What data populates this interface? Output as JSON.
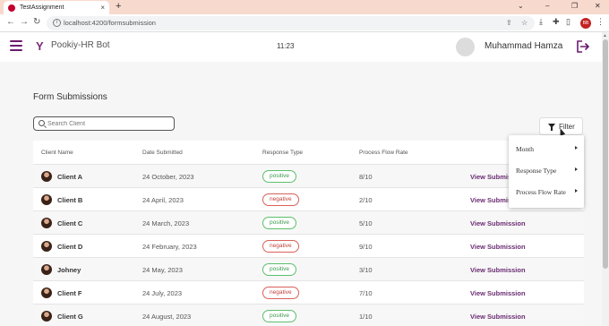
{
  "browser": {
    "tab_title": "TestAssignment",
    "tab_close": "×",
    "new_tab": "+",
    "url": "localhost:4200/formsubmission",
    "controls": {
      "minimize": "⌄",
      "dash": "–",
      "restore": "❐",
      "close": "✕"
    },
    "profile_initials": "BB"
  },
  "header": {
    "brand": "Pookiy-HR Bot",
    "time": "11:23",
    "user_name": "Muhammad Hamza"
  },
  "page": {
    "title": "Form Submissions",
    "search_placeholder": "Search Client",
    "filter_label": "Filter"
  },
  "table": {
    "columns": [
      "Client Name",
      "Date Submitted",
      "Response Type",
      "Process Flow Rate"
    ],
    "rows": [
      {
        "name": "Client A",
        "date": "24 October, 2023",
        "response": "positive",
        "rate": "8/10",
        "action": "View Submission"
      },
      {
        "name": "Client B",
        "date": "24 April, 2023",
        "response": "negative",
        "rate": "2/10",
        "action": "View Submission"
      },
      {
        "name": "Client C",
        "date": "24 March, 2023",
        "response": "positive",
        "rate": "5/10",
        "action": "View Submission"
      },
      {
        "name": "Client D",
        "date": "24 February, 2023",
        "response": "negative",
        "rate": "9/10",
        "action": "View Submission"
      },
      {
        "name": "Johney",
        "date": "24 May, 2023",
        "response": "positive",
        "rate": "3/10",
        "action": "View Submission"
      },
      {
        "name": "Client F",
        "date": "24 July, 2023",
        "response": "negative",
        "rate": "7/10",
        "action": "View Submission"
      },
      {
        "name": "Client G",
        "date": "24 August, 2023",
        "response": "positive",
        "rate": "1/10",
        "action": "View Submission"
      }
    ]
  },
  "filter_menu": {
    "items": [
      "Month",
      "Response Type",
      "Process Flow Rate"
    ]
  },
  "colors": {
    "brand_purple": "#6a1b6f",
    "positive": "#3e9a4f",
    "negative": "#c0443e",
    "tabstrip": "#f8d9ce"
  }
}
